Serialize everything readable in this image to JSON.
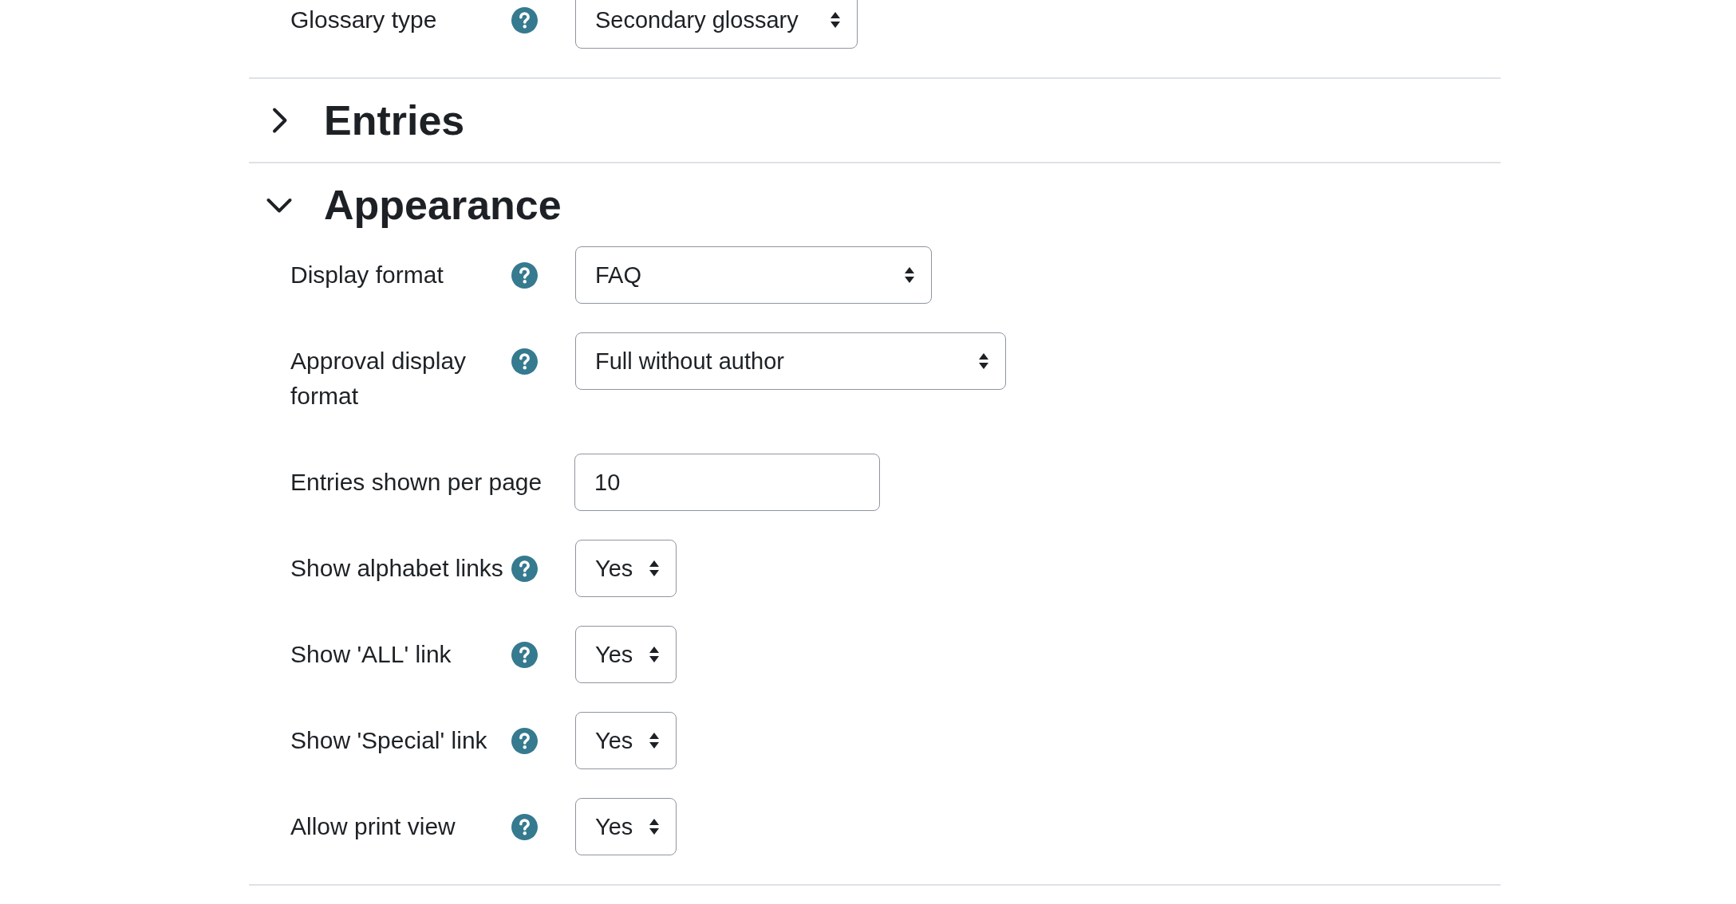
{
  "top_field": {
    "label": "Glossary type",
    "help": true,
    "kind": "select",
    "value": "Secondary glossary"
  },
  "sections": [
    {
      "title": "Entries",
      "expanded": false
    },
    {
      "title": "Appearance",
      "expanded": true,
      "fields": [
        {
          "label": "Display format",
          "help": true,
          "kind": "select",
          "value": "FAQ"
        },
        {
          "label": "Approval display format",
          "help": true,
          "kind": "select",
          "value": "Full without author"
        },
        {
          "label": "Entries shown per page",
          "help": false,
          "kind": "text",
          "value": "10"
        },
        {
          "label": "Show alphabet links",
          "help": true,
          "kind": "select",
          "value": "Yes"
        },
        {
          "label": "Show 'ALL' link",
          "help": true,
          "kind": "select",
          "value": "Yes"
        },
        {
          "label": "Show 'Special' link",
          "help": true,
          "kind": "select",
          "value": "Yes"
        },
        {
          "label": "Allow print view",
          "help": true,
          "kind": "select",
          "value": "Yes"
        }
      ]
    }
  ]
}
